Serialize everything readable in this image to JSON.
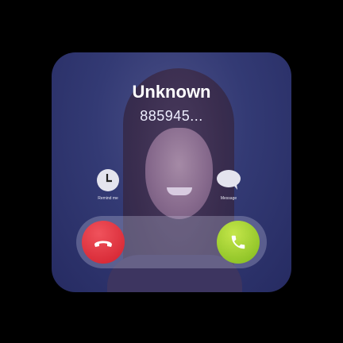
{
  "caller": {
    "name": "Unknown",
    "number": "885945..."
  },
  "actions": {
    "remind_label": "Remind me",
    "message_label": "Message"
  },
  "buttons": {
    "decline_icon": "phone-hangup-icon",
    "accept_icon": "phone-icon"
  },
  "colors": {
    "decline": "#d9252f",
    "accept": "#94c72a",
    "overlay": "#2d3270"
  }
}
